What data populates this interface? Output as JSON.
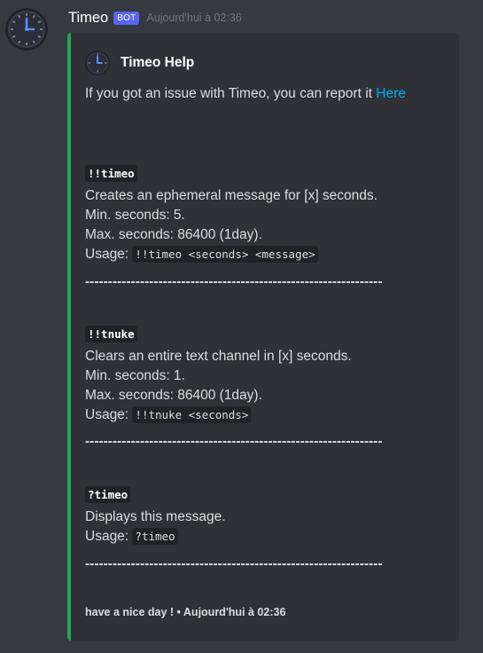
{
  "message": {
    "username": "Timeo",
    "bot_tag": "BOT",
    "timestamp": "Aujourd'hui à 02:36"
  },
  "embed": {
    "accent_color": "#23a55a",
    "author": "Timeo Help",
    "description_text": "If you got an issue with Timeo, you can report it ",
    "description_link": "Here",
    "commands": [
      {
        "name": "!!timeo",
        "lines": [
          "Creates an ephemeral message for [x] seconds.",
          "Min. seconds: 5.",
          "Max. seconds: 86400 (1day)."
        ],
        "usage_label": "Usage: ",
        "usage": "!!timeo <seconds> <message>"
      },
      {
        "name": "!!tnuke",
        "lines": [
          "Clears an entire text channel in [x] seconds.",
          "Min. seconds: 1.",
          "Max. seconds: 86400 (1day)."
        ],
        "usage_label": "Usage: ",
        "usage": "!!tnuke <seconds>"
      },
      {
        "name": "?timeo",
        "lines": [
          "Displays this message."
        ],
        "usage_label": "Usage: ",
        "usage": "?timeo"
      }
    ],
    "separator": "-----------------------------------------------------------------",
    "footer": "have a nice day ! • Aujourd'hui à 02:36"
  },
  "icons": {
    "avatar": "clock-icon",
    "author_icon": "clock-icon"
  },
  "colors": {
    "background": "#36393f",
    "embed_background": "#2f3136",
    "link": "#00aff4",
    "bot_tag": "#5865f2"
  }
}
